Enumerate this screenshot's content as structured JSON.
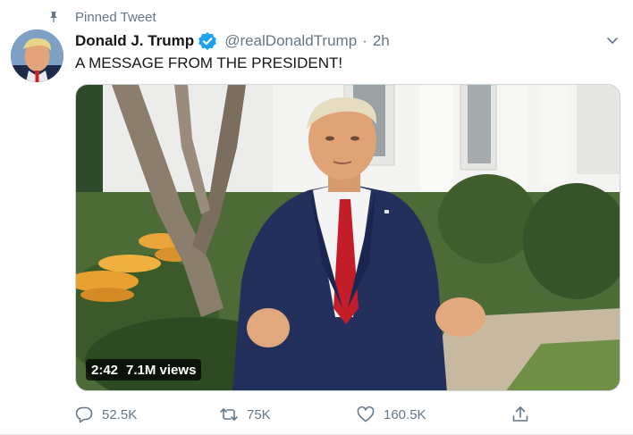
{
  "pinned": {
    "label": "Pinned Tweet",
    "icon": "pin-icon"
  },
  "author": {
    "display_name": "Donald J. Trump",
    "handle": "@realDonaldTrump",
    "separator": "·",
    "timestamp": "2h",
    "verified": true,
    "verified_color": "#1da1f2"
  },
  "tweet": {
    "text": "A MESSAGE FROM THE PRESIDENT!"
  },
  "media": {
    "type": "video",
    "duration": "2:42",
    "views": "7.1M views"
  },
  "actions": {
    "reply": {
      "icon": "reply-icon",
      "count": "52.5K"
    },
    "retweet": {
      "icon": "retweet-icon",
      "count": "75K"
    },
    "like": {
      "icon": "heart-icon",
      "count": "160.5K"
    },
    "share": {
      "icon": "share-icon"
    }
  },
  "colors": {
    "secondary_text": "#657786",
    "primary_text": "#14171a",
    "accent": "#1da1f2"
  }
}
